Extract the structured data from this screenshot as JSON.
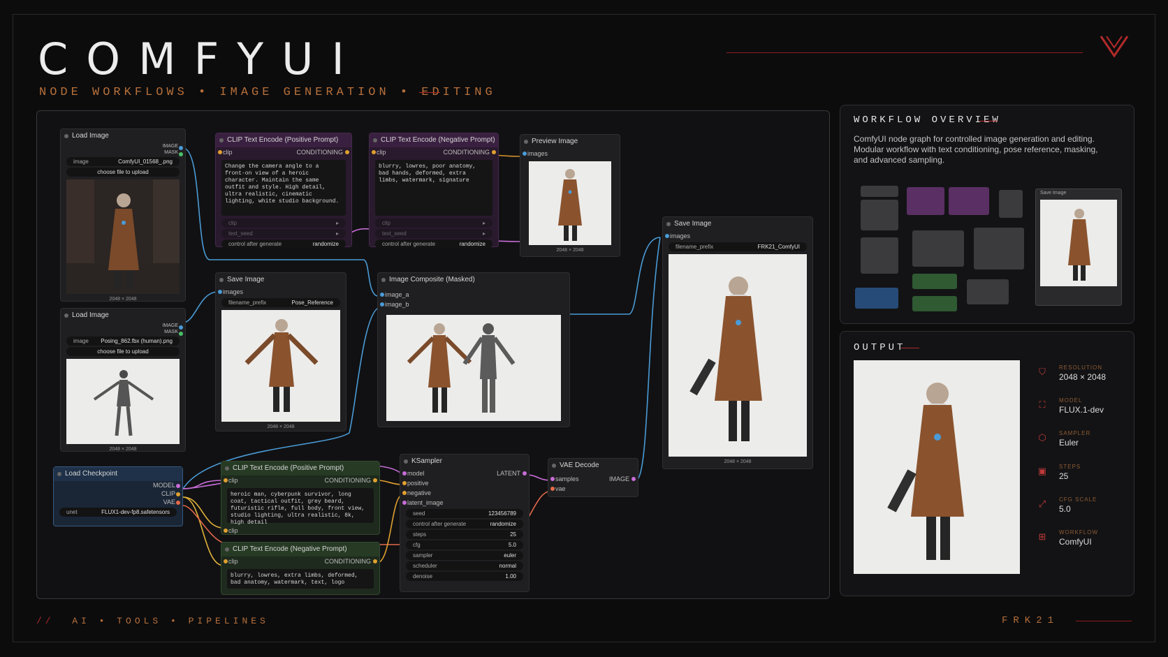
{
  "header": {
    "title": "COMFYUI",
    "subtitle": "NODE WORKFLOWS • IMAGE GENERATION • EDITING",
    "accent": "#b22a2a",
    "orange": "#b7703a"
  },
  "nodes": {
    "load_image_1": {
      "title": "Load Image",
      "out1": "IMAGE",
      "out2": "MASK",
      "image_label": "image",
      "image_value": "ComfyUI_01568_.png",
      "upload": "choose file to upload",
      "caption": "2048 × 2048"
    },
    "load_image_2": {
      "title": "Load Image",
      "out1": "IMAGE",
      "out2": "MASK",
      "image_label": "image",
      "image_value": "Posing_862.fbx (human).png",
      "upload": "choose file to upload",
      "caption": "2048 × 2048"
    },
    "clip_pos_top": {
      "title": "CLIP Text Encode (Positive Prompt)",
      "in": "clip",
      "out": "CONDITIONING",
      "text": "Change the camera angle to a front-on view of a heroic character. Maintain the same outfit and style. High detail, ultra realistic, cinematic lighting, white studio background.",
      "w1": "clip",
      "w2": "text_seed",
      "w3_label": "control after generate",
      "w3_value": "randomize"
    },
    "clip_neg_top": {
      "title": "CLIP Text Encode (Negative Prompt)",
      "in": "clip",
      "out": "CONDITIONING",
      "text": "blurry, lowres, poor anatomy, bad hands, deformed, extra limbs, watermark, signature",
      "w1": "clip",
      "w2": "text_seed",
      "w3_label": "control after generate",
      "w3_value": "randomize"
    },
    "preview_image": {
      "title": "Preview Image",
      "in": "images",
      "caption": "2048 × 2048"
    },
    "save_image_mid": {
      "title": "Save Image",
      "in": "images",
      "prefix_label": "filename_prefix",
      "prefix_value": "Pose_Reference",
      "caption": "2048 × 2048"
    },
    "image_composite": {
      "title": "Image Composite (Masked)",
      "in1": "image_a",
      "in2": "image_b"
    },
    "save_image_right": {
      "title": "Save Image",
      "in": "images",
      "prefix_label": "filename_prefix",
      "prefix_value": "FRK21_ComfyUI",
      "caption": "2048 × 2048"
    },
    "load_checkpoint": {
      "title": "Load Checkpoint",
      "out1": "MODEL",
      "out2": "CLIP",
      "out3": "VAE",
      "w_label": "unet",
      "w_value": "FLUX1-dev-fp8.safetensors"
    },
    "clip_pos_bottom": {
      "title": "CLIP Text Encode (Positive Prompt)",
      "in": "clip",
      "out": "CONDITIONING",
      "text": "heroic man, cyberpunk survivor, long coat, tactical outfit, grey beard, futuristic rifle, full body, front view, studio lighting, ultra realistic, 8k, high detail",
      "in2": "clip"
    },
    "clip_neg_bottom": {
      "title": "CLIP Text Encode (Negative Prompt)",
      "in": "clip",
      "out": "CONDITIONING",
      "text": "blurry, lowres, extra limbs, deformed, bad anatomy, watermark, text, logo"
    },
    "ksampler": {
      "title": "KSampler",
      "inputs": [
        "model",
        "positive",
        "negative",
        "latent_image"
      ],
      "out": "LATENT",
      "widgets": [
        {
          "label": "seed",
          "value": "123456789"
        },
        {
          "label": "control after generate",
          "value": "randomize"
        },
        {
          "label": "steps",
          "value": "25"
        },
        {
          "label": "cfg",
          "value": "5.0"
        },
        {
          "label": "sampler",
          "value": "euler"
        },
        {
          "label": "scheduler",
          "value": "normal"
        },
        {
          "label": "denoise",
          "value": "1.00"
        }
      ]
    },
    "vae_decode": {
      "title": "VAE Decode",
      "in1": "samples",
      "in2": "vae",
      "out": "IMAGE"
    }
  },
  "overview": {
    "title": "WORKFLOW OVERVIEW",
    "description": "ComfyUI node graph for controlled image generation and editing. Modular workflow with text conditioning, pose reference, masking, and advanced sampling.",
    "mini_label": "Save Image"
  },
  "output": {
    "title": "OUTPUT",
    "stats": [
      {
        "label": "RESOLUTION",
        "value": "2048 × 2048",
        "icon": "frame-icon"
      },
      {
        "label": "MODEL",
        "value": "FLUX.1-dev",
        "icon": "model-icon"
      },
      {
        "label": "SAMPLER",
        "value": "Euler",
        "icon": "sampler-icon"
      },
      {
        "label": "STEPS",
        "value": "25",
        "icon": "steps-icon"
      },
      {
        "label": "CFG SCALE",
        "value": "5.0",
        "icon": "cfg-icon"
      },
      {
        "label": "WORKFLOW",
        "value": "ComfyUI",
        "icon": "workflow-icon"
      }
    ]
  },
  "footer": {
    "slashes": "//",
    "left": "AI • TOOLS • PIPELINES",
    "right": "FRK21"
  }
}
